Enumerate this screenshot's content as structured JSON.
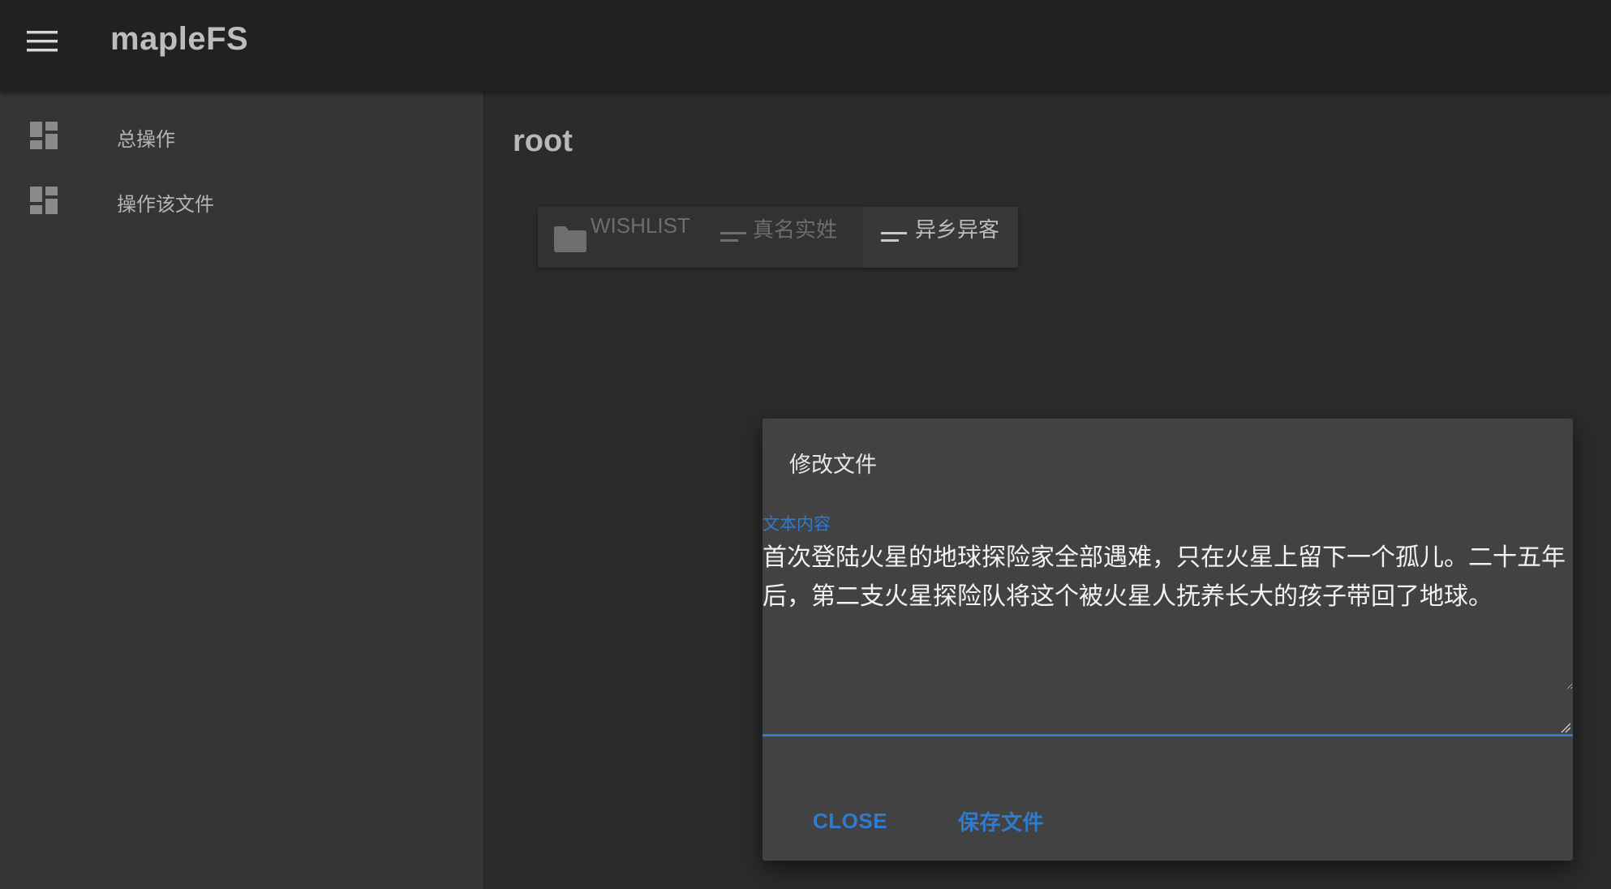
{
  "appbar": {
    "title": "mapleFS",
    "menu_icon": "hamburger-menu-icon"
  },
  "drawer": {
    "items": [
      {
        "label": "总操作",
        "icon": "dashboard-icon"
      },
      {
        "label": "操作该文件",
        "icon": "dashboard-icon"
      }
    ]
  },
  "main": {
    "title": "root",
    "files": [
      {
        "name": "WISHLIST",
        "icon": "folder-icon",
        "type": "folder"
      },
      {
        "name": "真名实姓",
        "icon": "text-file-icon",
        "type": "file"
      },
      {
        "name": "异乡异客",
        "icon": "text-file-icon",
        "type": "file",
        "selected": true
      }
    ]
  },
  "dialog": {
    "title": "修改文件",
    "field_label": "文本内容",
    "content": "首次登陆火星的地球探险家全部遇难，只在火星上留下一个孤儿。二十五年后，第二支火星探险队将这个被火星人抚养长大的孩子带回了地球。",
    "close_label": "CLOSE",
    "save_label": "保存文件"
  },
  "colors": {
    "accent": "#2f7bd0",
    "appbar": "#212121",
    "drawer": "#353535",
    "dialog": "#424242"
  }
}
